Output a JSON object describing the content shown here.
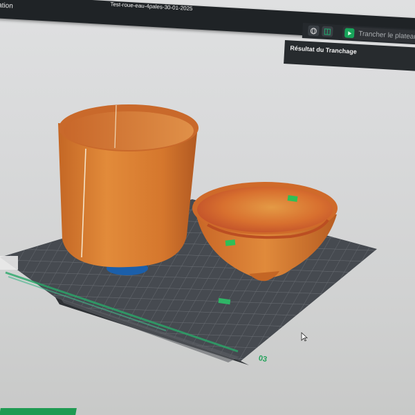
{
  "app": {
    "menu_fragment": "ation",
    "document_title": "Test-roue-eau-4pales-30-01-2025"
  },
  "toolbar": {
    "view_icon_1": "globe-icon",
    "view_icon_2": "layers-icon",
    "slice_button_label": "Trancher le plateau",
    "slice_icon": "play-icon"
  },
  "panel": {
    "result_label": "Résultat du Tranchage"
  },
  "plate": {
    "label": "03",
    "accent_color": "#1f9a52"
  },
  "colors": {
    "filament": "#d5772d",
    "filament_infill": "#cd5a24",
    "support_interface": "#1b5faa",
    "bed": "#474b51",
    "toolbar_bg": "#1f2326"
  }
}
